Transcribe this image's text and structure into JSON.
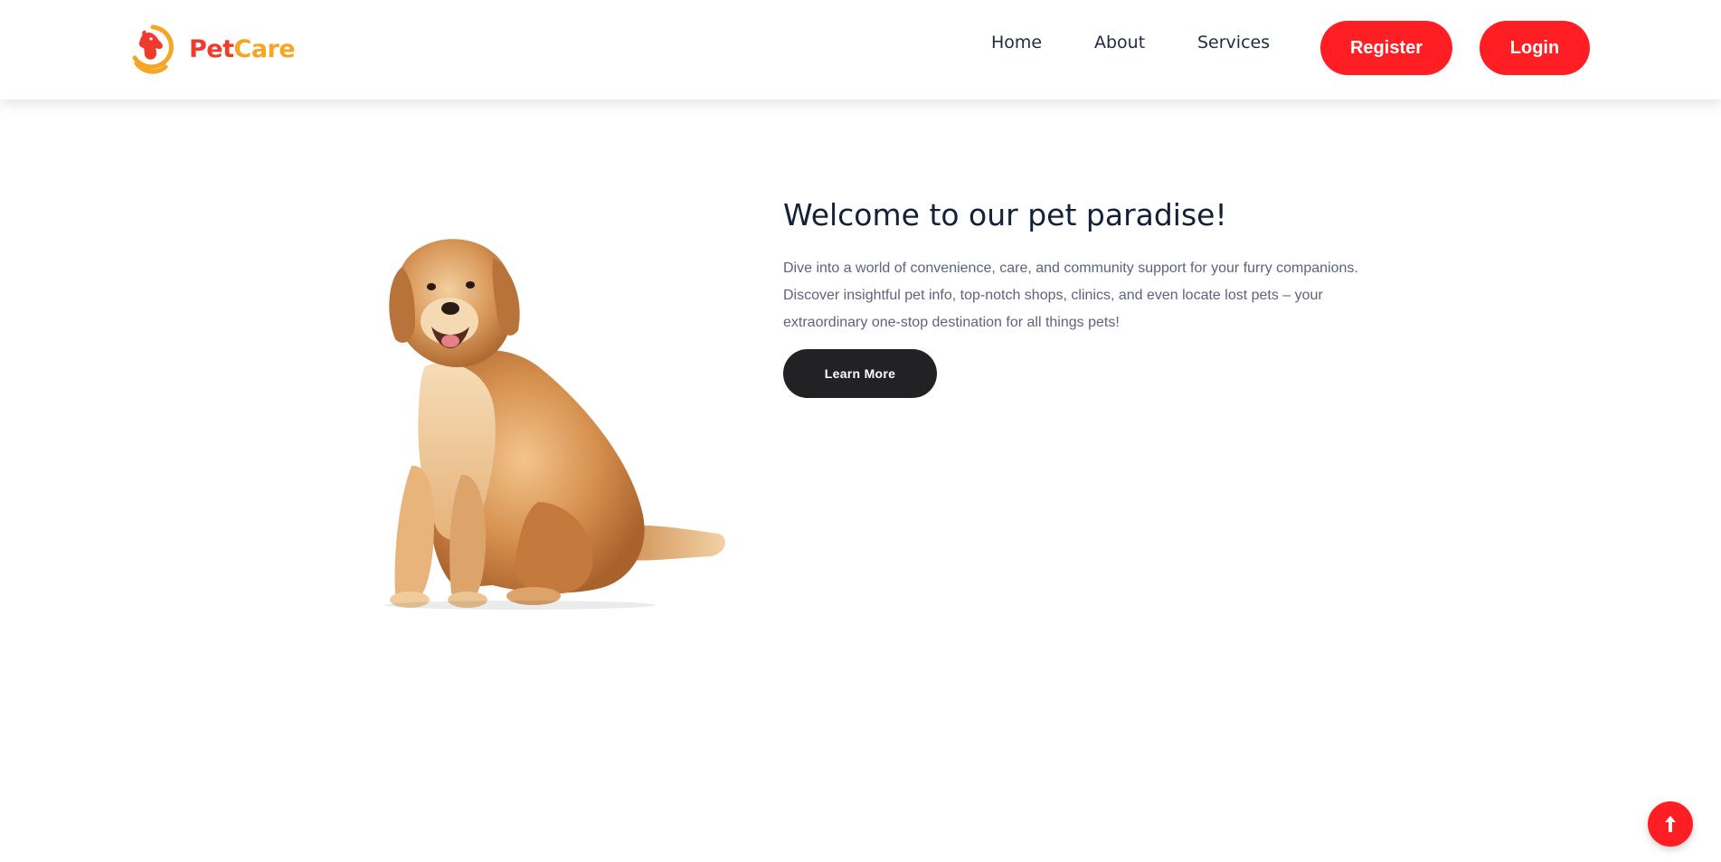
{
  "brand": {
    "name_part1": "Pet",
    "name_part2": "Care",
    "logo_icon": "dog-paw-logo-icon",
    "colors": {
      "primary_red": "#ef3a2d",
      "accent_orange": "#f5a623"
    }
  },
  "nav": {
    "links": [
      {
        "label": "Home"
      },
      {
        "label": "About"
      },
      {
        "label": "Services"
      }
    ],
    "register_label": "Register",
    "login_label": "Login"
  },
  "hero": {
    "title": "Welcome to our pet paradise!",
    "description": "Dive into a world of convenience, care, and community support for your furry companions. Discover insightful pet info, top-notch shops, clinics, and even locate lost pets – your extraordinary one-stop destination for all things pets!",
    "cta_label": "Learn More",
    "image_subject": "golden-retriever"
  },
  "scroll_top": {
    "icon": "arrow-up-icon"
  },
  "theme": {
    "accent": "#ff1e24",
    "dark_button": "#222224",
    "heading_color": "#13203a",
    "text_color": "#5c6577"
  }
}
